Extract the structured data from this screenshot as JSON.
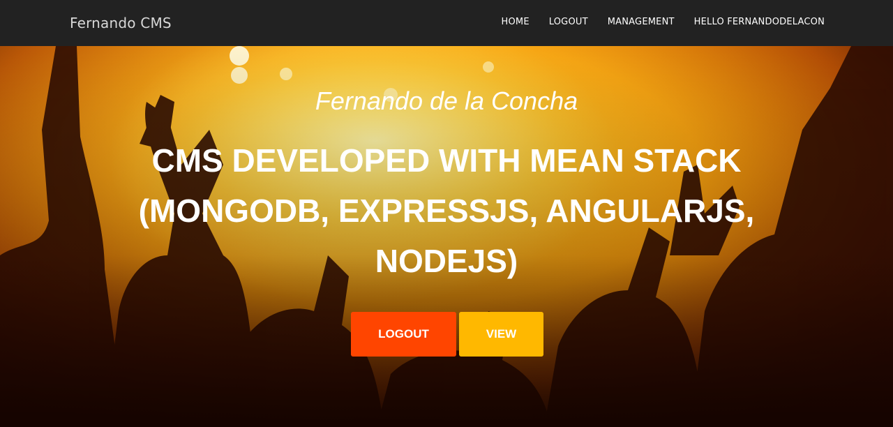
{
  "navbar": {
    "brand": "Fernando CMS",
    "links": [
      "HOME",
      "LOGOUT",
      "MANAGEMENT",
      "HELLO FERNANDODELACON"
    ]
  },
  "hero": {
    "subtitle": "Fernando de la Concha",
    "headline": "CMS DEVELOPED WITH MEAN STACK (MONGODB, EXPRESSJS, ANGULARJS, NODEJS)",
    "logout_button": "LOGOUT",
    "view_button": "VIEW",
    "background_image": "concert crowd with raised hands silhouetted against bright yellow stage lights"
  },
  "colors": {
    "navbar_bg": "#222222",
    "logout_button": "#ff4500",
    "view_button": "#ffb800"
  }
}
